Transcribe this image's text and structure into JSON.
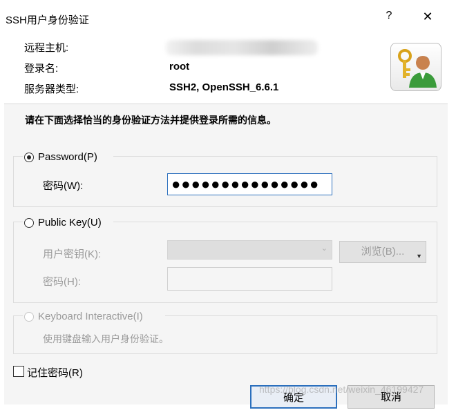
{
  "window": {
    "title": "SSH用户身份验证",
    "help_label": "?",
    "close_label": "✕"
  },
  "info": {
    "remote_host_label": "远程主机:",
    "login_name_label": "登录名:",
    "login_name_value": "root",
    "server_type_label": "服务器类型:",
    "server_type_value": "SSH2, OpenSSH_6.6.1"
  },
  "instructions": "请在下面选择恰当的身份验证方法并提供登录所需的信息。",
  "password_group": {
    "radio_label": "Password(P)",
    "selected": true,
    "field_label": "密码(W):",
    "field_value": "●●●●●●●●●●●●●●●"
  },
  "public_key_group": {
    "radio_label": "Public Key(U)",
    "selected": false,
    "user_key_label": "用户密钥(K):",
    "browse_label": "浏览(B)...",
    "passphrase_label": "密码(H):"
  },
  "keyboard_group": {
    "radio_label": "Keyboard Interactive(I)",
    "enabled": false,
    "description": "使用键盘输入用户身份验证。"
  },
  "remember_password": {
    "label": "记住密码(R)",
    "checked": false
  },
  "buttons": {
    "ok_label": "确定",
    "cancel_label": "取消"
  },
  "watermark": "https://blog.csdn.net/weixin_46199427",
  "colors": {
    "focus_border": "#2b6fbd",
    "panel_bg": "#f5f5f5",
    "disabled_text": "#9a9a9a"
  },
  "icons": {
    "app_icon": "user-key-icon",
    "radio": "radio-button",
    "checkbox": "checkbox"
  }
}
